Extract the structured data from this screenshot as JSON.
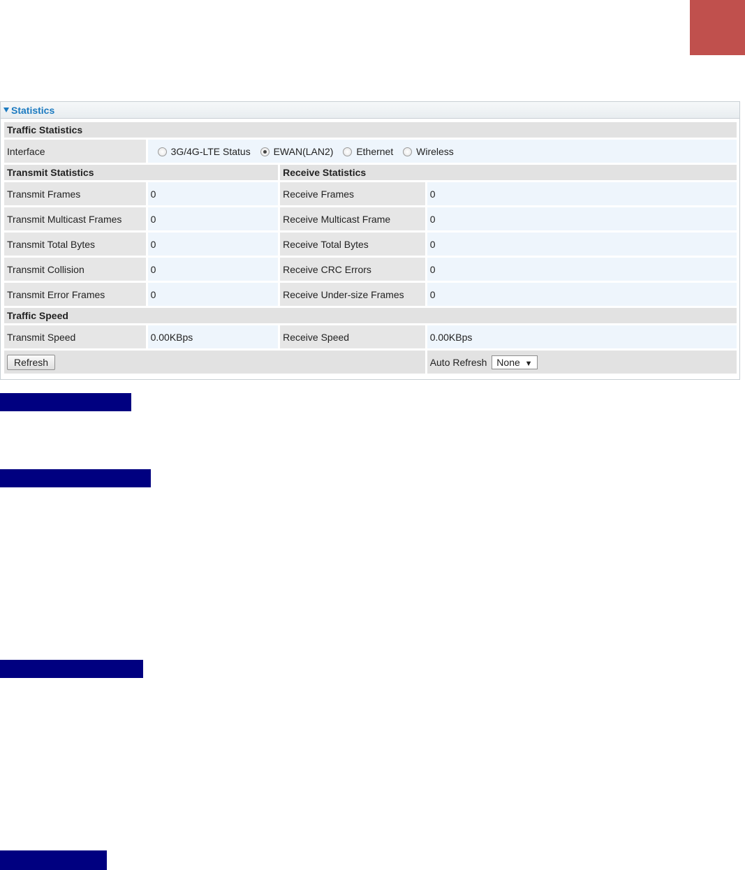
{
  "panel": {
    "title": "Statistics"
  },
  "traffic_statistics": {
    "heading": "Traffic Statistics",
    "interface_label": "Interface",
    "options": [
      {
        "label": "3G/4G-LTE Status",
        "selected": false
      },
      {
        "label": "EWAN(LAN2)",
        "selected": true
      },
      {
        "label": "Ethernet",
        "selected": false
      },
      {
        "label": "Wireless",
        "selected": false
      }
    ]
  },
  "transmit": {
    "heading": "Transmit Statistics",
    "rows": [
      {
        "label": "Transmit Frames",
        "value": "0"
      },
      {
        "label": "Transmit Multicast Frames",
        "value": "0"
      },
      {
        "label": "Transmit Total Bytes",
        "value": "0"
      },
      {
        "label": "Transmit Collision",
        "value": "0"
      },
      {
        "label": "Transmit Error Frames",
        "value": "0"
      }
    ]
  },
  "receive": {
    "heading": "Receive Statistics",
    "rows": [
      {
        "label": "Receive Frames",
        "value": "0"
      },
      {
        "label": "Receive Multicast Frame",
        "value": "0"
      },
      {
        "label": "Receive Total Bytes",
        "value": "0"
      },
      {
        "label": "Receive CRC Errors",
        "value": "0"
      },
      {
        "label": "Receive Under-size Frames",
        "value": "0"
      }
    ]
  },
  "traffic_speed": {
    "heading": "Traffic Speed",
    "transmit_label": "Transmit Speed",
    "transmit_value": "0.00KBps",
    "receive_label": "Receive Speed",
    "receive_value": "0.00KBps"
  },
  "footer": {
    "refresh_label": "Refresh",
    "auto_refresh_label": "Auto Refresh",
    "auto_refresh_value": "None",
    "dropdown_arrow": "▼"
  },
  "colors": {
    "accent_tab": "#c0504d",
    "header_text": "#1b7ac0",
    "highlight_bar": "#000080"
  }
}
